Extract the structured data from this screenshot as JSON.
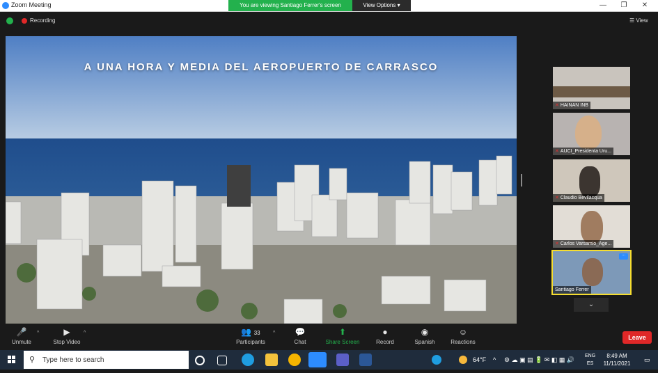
{
  "window": {
    "title": "Zoom Meeting",
    "banner": "You are viewing Santiago Ferrer's screen",
    "view_options": "View Options",
    "min": "—",
    "max": "❐",
    "close": "✕"
  },
  "topbar": {
    "recording": "Recording",
    "view": "View"
  },
  "shared_screen": {
    "overlay_text": "A UNA HORA Y MEDIA DEL AEROPUERTO DE CARRASCO"
  },
  "participants": [
    {
      "name": "HAINAN INB"
    },
    {
      "name": "AUCI_Presidenta Uru..."
    },
    {
      "name": "Claudio Bevilacqua"
    },
    {
      "name": "Carlos Varsamio_Age..."
    },
    {
      "name": "Santiago Ferrer"
    }
  ],
  "toolbar": {
    "unmute": "Unmute",
    "stop_video": "Stop Video",
    "participants": "Participants",
    "participant_count": "33",
    "chat": "Chat",
    "share_screen": "Share Screen",
    "record": "Record",
    "language": "Spanish",
    "reactions": "Reactions",
    "leave": "Leave"
  },
  "taskbar": {
    "search_placeholder": "Type here to search",
    "temperature": "64°F",
    "lang_top": "ENG",
    "lang_bottom": "ES",
    "time": "8:49 AM",
    "date": "11/11/2021"
  },
  "colors": {
    "accent_green": "#23b14d",
    "leave_red": "#e02828",
    "active_speaker": "#f5dd31",
    "zoom_blue": "#2d8cff"
  }
}
